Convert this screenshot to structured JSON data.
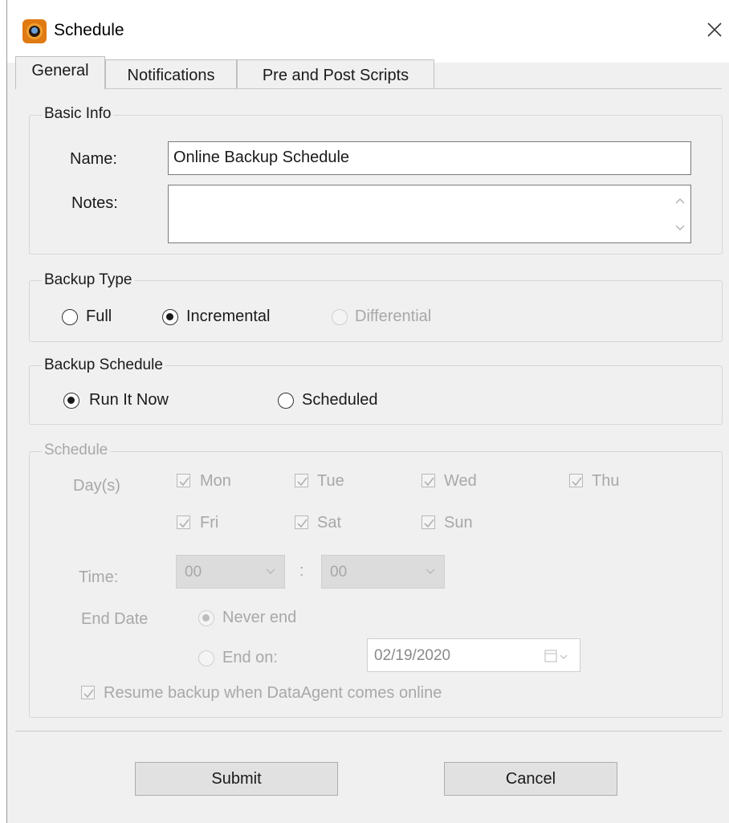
{
  "window": {
    "title": "Schedule"
  },
  "tabs": [
    {
      "label": "General"
    },
    {
      "label": "Notifications"
    },
    {
      "label": "Pre and Post Scripts"
    }
  ],
  "basic_info": {
    "legend": "Basic Info",
    "name_label": "Name:",
    "name_value": "Online Backup Schedule",
    "notes_label": "Notes:",
    "notes_value": ""
  },
  "backup_type": {
    "legend": "Backup Type",
    "options": [
      {
        "label": "Full",
        "selected": false,
        "enabled": true
      },
      {
        "label": "Incremental",
        "selected": true,
        "enabled": true
      },
      {
        "label": "Differential",
        "selected": false,
        "enabled": false
      }
    ]
  },
  "backup_schedule": {
    "legend": "Backup Schedule",
    "options": [
      {
        "label": "Run It Now",
        "selected": true
      },
      {
        "label": "Scheduled",
        "selected": false
      }
    ]
  },
  "schedule": {
    "legend": "Schedule",
    "days_label": "Day(s)",
    "days": [
      {
        "label": "Mon",
        "checked": true
      },
      {
        "label": "Tue",
        "checked": true
      },
      {
        "label": "Wed",
        "checked": true
      },
      {
        "label": "Thu",
        "checked": true
      },
      {
        "label": "Fri",
        "checked": true
      },
      {
        "label": "Sat",
        "checked": true
      },
      {
        "label": "Sun",
        "checked": true
      }
    ],
    "time_label": "Time:",
    "hour": "00",
    "time_separator": ":",
    "minute": "00",
    "end_date_label": "End Date",
    "never_end_label": "Never end",
    "end_on_label": "End on:",
    "end_date_value": "02/19/2020",
    "resume_label": "Resume backup when DataAgent comes online",
    "resume_checked": true
  },
  "buttons": {
    "submit": "Submit",
    "cancel": "Cancel"
  },
  "colors": {
    "window_bg": "#f0f0f0",
    "disabled_text": "#a8a8a8",
    "button_bg": "#e1e1e1"
  }
}
